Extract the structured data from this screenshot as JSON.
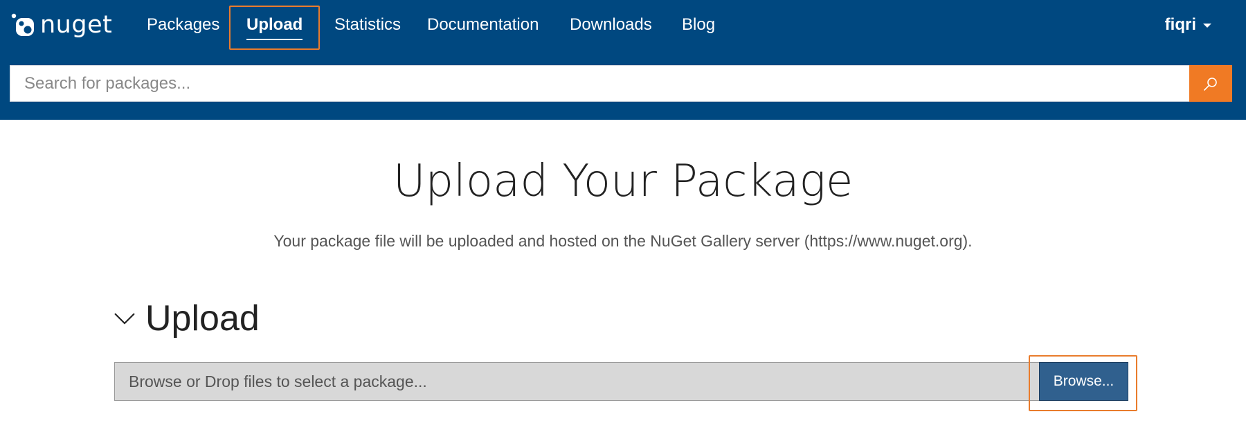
{
  "brand": {
    "name": "nuget"
  },
  "nav": {
    "items": [
      {
        "label": "Packages",
        "active": false
      },
      {
        "label": "Upload",
        "active": true
      },
      {
        "label": "Statistics",
        "active": false
      },
      {
        "label": "Documentation",
        "active": false
      },
      {
        "label": "Downloads",
        "active": false
      },
      {
        "label": "Blog",
        "active": false
      }
    ]
  },
  "user": {
    "name": "fiqri",
    "dropdown_icon": "caret-down-icon"
  },
  "search": {
    "placeholder": "Search for packages...",
    "value": "",
    "button_icon": "search-icon"
  },
  "main": {
    "title": "Upload Your Package",
    "subtitle": "Your package file will be uploaded and hosted on the NuGet Gallery server (https://www.nuget.org).",
    "section": {
      "title": "Upload",
      "toggle_icon": "chevron-down-icon",
      "file_placeholder": "Browse or Drop files to select a package...",
      "browse_label": "Browse..."
    }
  },
  "colors": {
    "header_bg": "#004880",
    "accent_orange": "#f07a24",
    "highlight_orange": "#e97c2c",
    "browse_button": "#30608e"
  }
}
